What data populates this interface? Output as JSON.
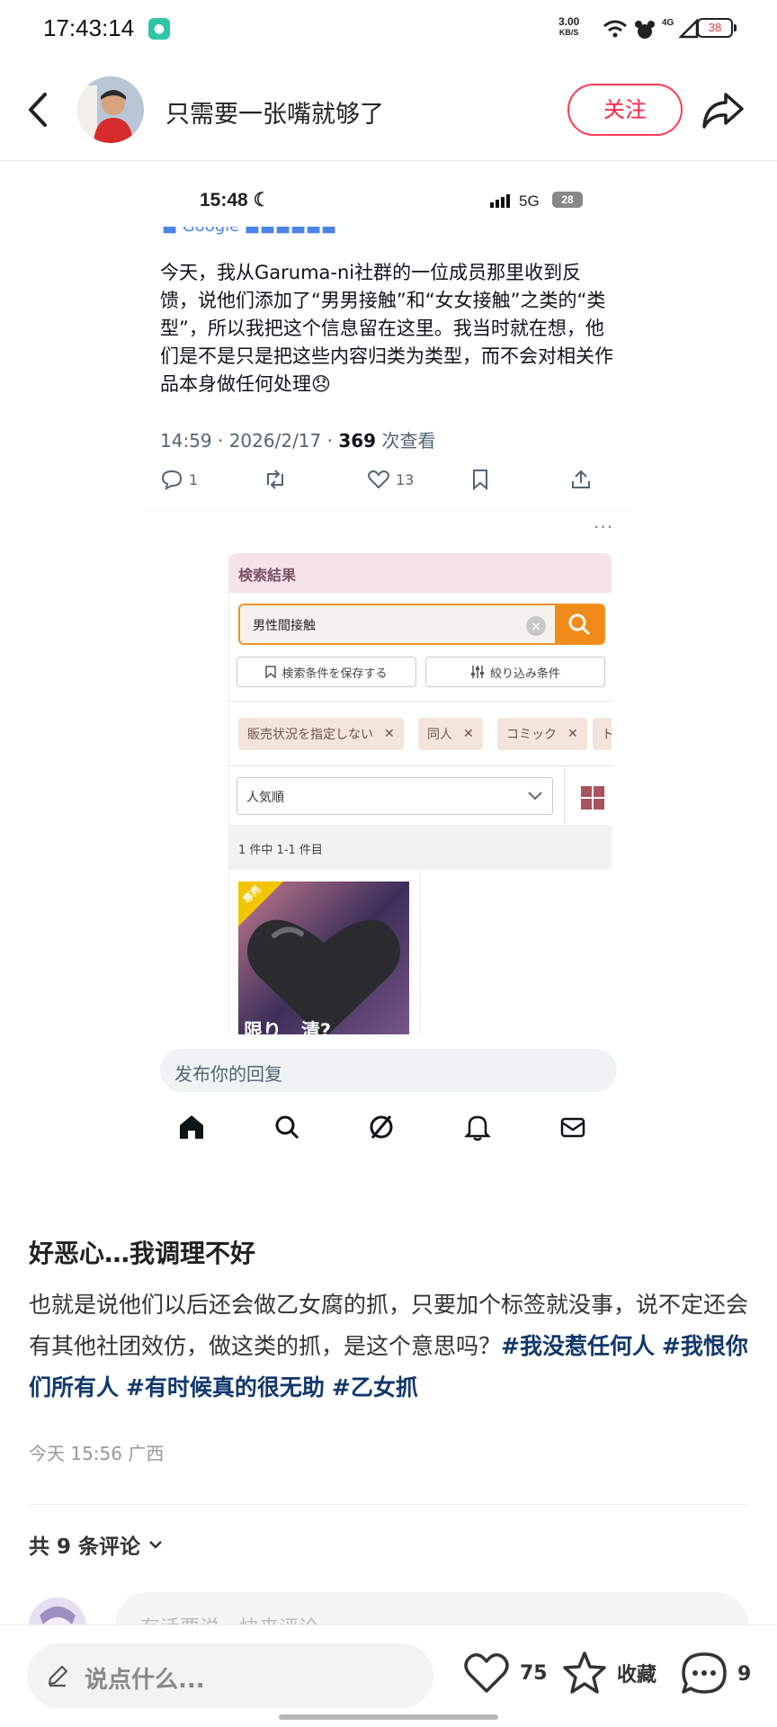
{
  "status_bar": {
    "time": "17:43:14",
    "net_speed_value": "3.00",
    "net_speed_unit": "KB/S",
    "signal_label": "4G",
    "battery": "38"
  },
  "header": {
    "author_name": "只需要一张嘴就够了",
    "follow_label": "关注"
  },
  "embedded_screenshot": {
    "time": "15:48",
    "network": "5G",
    "battery": "28",
    "tweet_text": "今天，我从Garuma-ni社群的一位成员那里收到反馈，说他们添加了“男男接触”和“女女接触”之类的“类型”，所以我把这个信息留在这里。我当时就在想，他们是不是只是把这些内容归类为类型，而不会对相关作品本身做任何处理😞",
    "meta_time": "14:59 · 2026/2/17 · ",
    "views_count": "369",
    "views_label": " 次查看",
    "reply_count": "1",
    "like_count": "13",
    "jp": {
      "header": "検索結果",
      "search_value": "男性間接触",
      "save_button": "検索条件を保存する",
      "filter_button": "絞り込み条件",
      "tags": [
        "販売状況を指定しない",
        "同人",
        "コミック",
        "ト"
      ],
      "sort_value": "人気順",
      "result_count": "1 件中 1-1 件目",
      "badge": "専売",
      "cover_text": "限り   清?"
    },
    "reply_placeholder": "发布你的回复"
  },
  "post": {
    "title": "好恶心…我调理不好",
    "body_text": "也就是说他们以后还会做乙女腐的抓，只要加个标签就没事，说不定还会有其他社团效仿，做这类的抓，是这个意思吗？",
    "tags": [
      "#我没惹任何人",
      "#我恨你们所有人",
      "#有时候真的很无助",
      "#乙女抓"
    ],
    "date_location": "今天 15:56 广西"
  },
  "comments": {
    "count_label": "共 9 条评论",
    "input_placeholder": "有话要说，快来评论"
  },
  "bottom_bar": {
    "input_placeholder": "说点什么...",
    "like_count": "75",
    "collect_label": "收藏",
    "comment_count": "9"
  },
  "colors": {
    "accent_red": "#ff2442",
    "hashtag_blue": "#13386c",
    "search_orange": "#f08a1a"
  }
}
